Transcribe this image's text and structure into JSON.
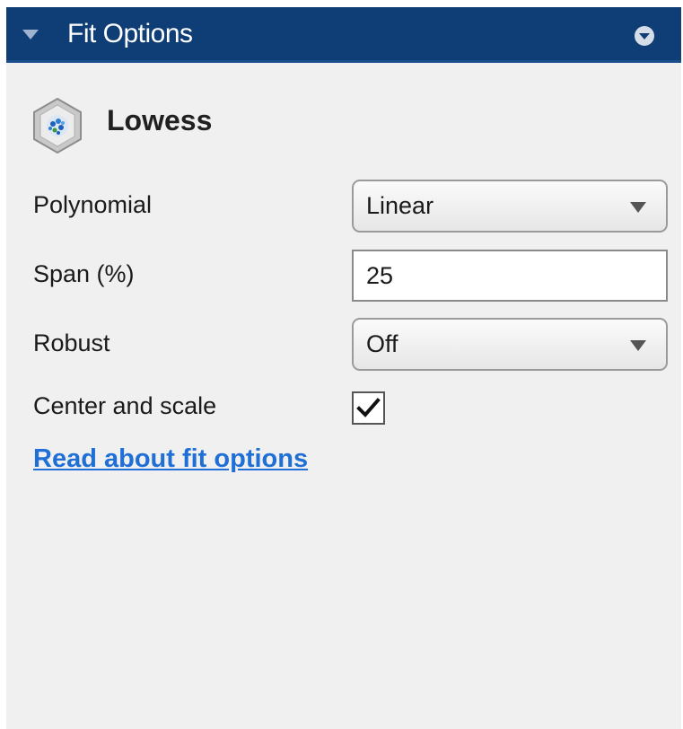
{
  "header": {
    "title": "Fit Options",
    "collapse_icon": "triangle-down-icon",
    "menu_icon": "circle-chevron-down-icon",
    "background_color": "#0f3d75"
  },
  "fit": {
    "name": "Lowess",
    "icon": "lowess-fit-icon"
  },
  "options": {
    "polynomial": {
      "label": "Polynomial",
      "value": "Linear"
    },
    "span": {
      "label": "Span (%)",
      "value": "25"
    },
    "robust": {
      "label": "Robust",
      "value": "Off"
    },
    "center_and_scale": {
      "label": "Center and scale",
      "checked": true
    }
  },
  "link": {
    "text": "Read about fit options",
    "color": "#1f6fd6"
  }
}
